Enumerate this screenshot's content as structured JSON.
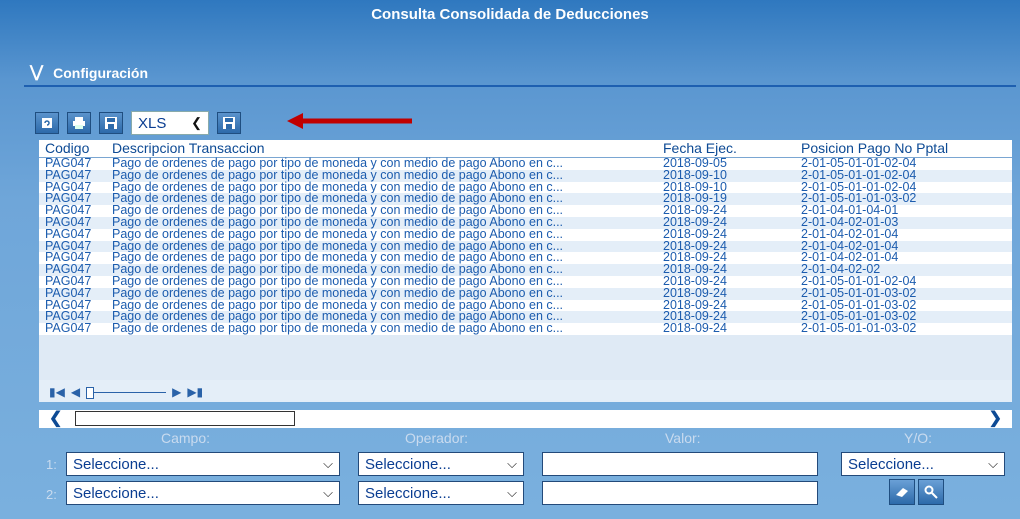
{
  "title": "Consulta Consolidada de Deducciones",
  "config": {
    "label": "Configuración"
  },
  "toolbar": {
    "format_value": "XLS"
  },
  "table": {
    "columns": [
      "Codigo",
      "Descripcion Transaccion",
      "Fecha Ejec.",
      "Posicion Pago No Pptal"
    ],
    "rows": [
      [
        "PAG047",
        "Pago de ordenes de pago por tipo de moneda y con medio de pago Abono en c...",
        "2018-09-05",
        "2-01-05-01-01-02-04"
      ],
      [
        "PAG047",
        "Pago de ordenes de pago por tipo de moneda y con medio de pago Abono en c...",
        "2018-09-10",
        "2-01-05-01-01-02-04"
      ],
      [
        "PAG047",
        "Pago de ordenes de pago por tipo de moneda y con medio de pago Abono en c...",
        "2018-09-10",
        "2-01-05-01-01-02-04"
      ],
      [
        "PAG047",
        "Pago de ordenes de pago por tipo de moneda y con medio de pago Abono en c...",
        "2018-09-19",
        "2-01-05-01-01-03-02"
      ],
      [
        "PAG047",
        "Pago de ordenes de pago por tipo de moneda y con medio de pago Abono en c...",
        "2018-09-24",
        "2-01-04-01-04-01"
      ],
      [
        "PAG047",
        "Pago de ordenes de pago por tipo de moneda y con medio de pago Abono en c...",
        "2018-09-24",
        "2-01-04-02-01-03"
      ],
      [
        "PAG047",
        "Pago de ordenes de pago por tipo de moneda y con medio de pago Abono en c...",
        "2018-09-24",
        "2-01-04-02-01-04"
      ],
      [
        "PAG047",
        "Pago de ordenes de pago por tipo de moneda y con medio de pago Abono en c...",
        "2018-09-24",
        "2-01-04-02-01-04"
      ],
      [
        "PAG047",
        "Pago de ordenes de pago por tipo de moneda y con medio de pago Abono en c...",
        "2018-09-24",
        "2-01-04-02-01-04"
      ],
      [
        "PAG047",
        "Pago de ordenes de pago por tipo de moneda y con medio de pago Abono en c...",
        "2018-09-24",
        "2-01-04-02-02"
      ],
      [
        "PAG047",
        "Pago de ordenes de pago por tipo de moneda y con medio de pago Abono en c...",
        "2018-09-24",
        "2-01-05-01-01-02-04"
      ],
      [
        "PAG047",
        "Pago de ordenes de pago por tipo de moneda y con medio de pago Abono en c...",
        "2018-09-24",
        "2-01-05-01-01-03-02"
      ],
      [
        "PAG047",
        "Pago de ordenes de pago por tipo de moneda y con medio de pago Abono en c...",
        "2018-09-24",
        "2-01-05-01-01-03-02"
      ],
      [
        "PAG047",
        "Pago de ordenes de pago por tipo de moneda y con medio de pago Abono en c...",
        "2018-09-24",
        "2-01-05-01-01-03-02"
      ],
      [
        "PAG047",
        "Pago de ordenes de pago por tipo de moneda y con medio de pago Abono en c...",
        "2018-09-24",
        "2-01-05-01-01-03-02"
      ]
    ]
  },
  "filters": {
    "labels": {
      "campo": "Campo:",
      "operador": "Operador:",
      "valor": "Valor:",
      "yo": "Y/O:"
    },
    "rows": [
      {
        "num": "1:",
        "campo": "Seleccione...",
        "operador": "Seleccione...",
        "valor": "",
        "yo": "Seleccione..."
      },
      {
        "num": "2:",
        "campo": "Seleccione...",
        "operador": "Seleccione...",
        "valor": ""
      }
    ]
  },
  "colors": {
    "accent": "#2f78bf",
    "link_text": "#1c5cae",
    "arrow": "#c00000"
  },
  "icons": [
    "chevron-double-down-icon",
    "refresh-icon",
    "print-icon",
    "save-icon",
    "export-icon",
    "first-page-icon",
    "prev-page-icon",
    "next-page-icon",
    "last-page-icon",
    "scroll-left-icon",
    "scroll-right-icon",
    "eraser-icon",
    "search-icon"
  ]
}
